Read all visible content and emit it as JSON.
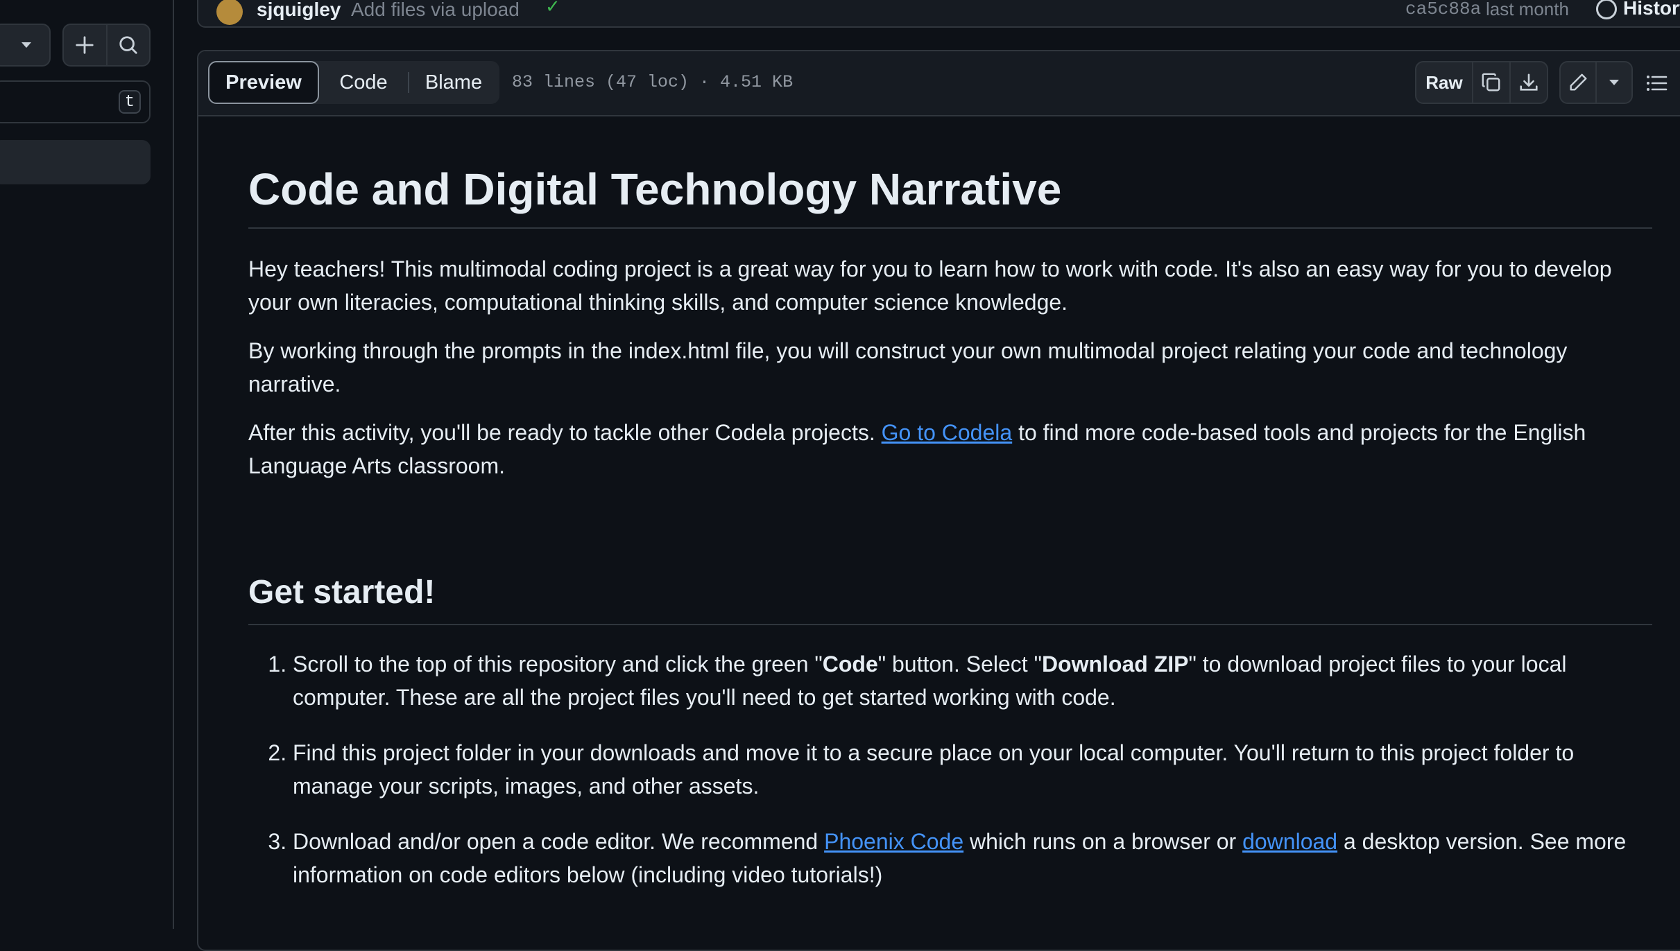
{
  "sidebar": {
    "go_to_file_shortcut": "t"
  },
  "commit": {
    "author": "sjquigley",
    "message": "Add files via upload",
    "sha": "ca5c88a",
    "time": "last month",
    "history_label": "History"
  },
  "file_header": {
    "tabs": [
      {
        "label": "Preview",
        "active": true
      },
      {
        "label": "Code",
        "active": false
      },
      {
        "label": "Blame",
        "active": false
      }
    ],
    "info": "83 lines (47 loc) · 4.51 KB",
    "raw_label": "Raw"
  },
  "readme": {
    "title": "Code and Digital Technology Narrative",
    "p1": "Hey teachers! This multimodal coding project is a great way for you to learn how to work with code. It's also an easy way for you to develop your own literacies, computational thinking skills, and computer science knowledge.",
    "p2": "By working through the prompts in the index.html file, you will construct your own multimodal project relating your code and technology narrative.",
    "p3_before": "After this activity, you'll be ready to tackle other Codela projects. ",
    "p3_link": "Go to Codela",
    "p3_after": " to find more code-based tools and projects for the English Language Arts classroom.",
    "h2": "Get started!",
    "steps": {
      "s1_a": "Scroll to the top of this repository and click the green \"",
      "s1_b": "Code",
      "s1_c": "\" button. Select \"",
      "s1_d": "Download ZIP",
      "s1_e": "\" to download project files to your local computer. These are all the project files you'll need to get started working with code.",
      "s2": "Find this project folder in your downloads and move it to a secure place on your local computer. You'll return to this project folder to manage your scripts, images, and other assets.",
      "s3_a": "Download and/or open a code editor. We recommend ",
      "s3_link1": "Phoenix Code",
      "s3_b": " which runs on a browser or ",
      "s3_link2": "download",
      "s3_c": " a desktop version. See more information on code editors below (including video tutorials!)"
    }
  },
  "colors": {
    "background": "#0d1117",
    "border": "#30363d",
    "link": "#4493f8",
    "text": "#e6edf3"
  }
}
